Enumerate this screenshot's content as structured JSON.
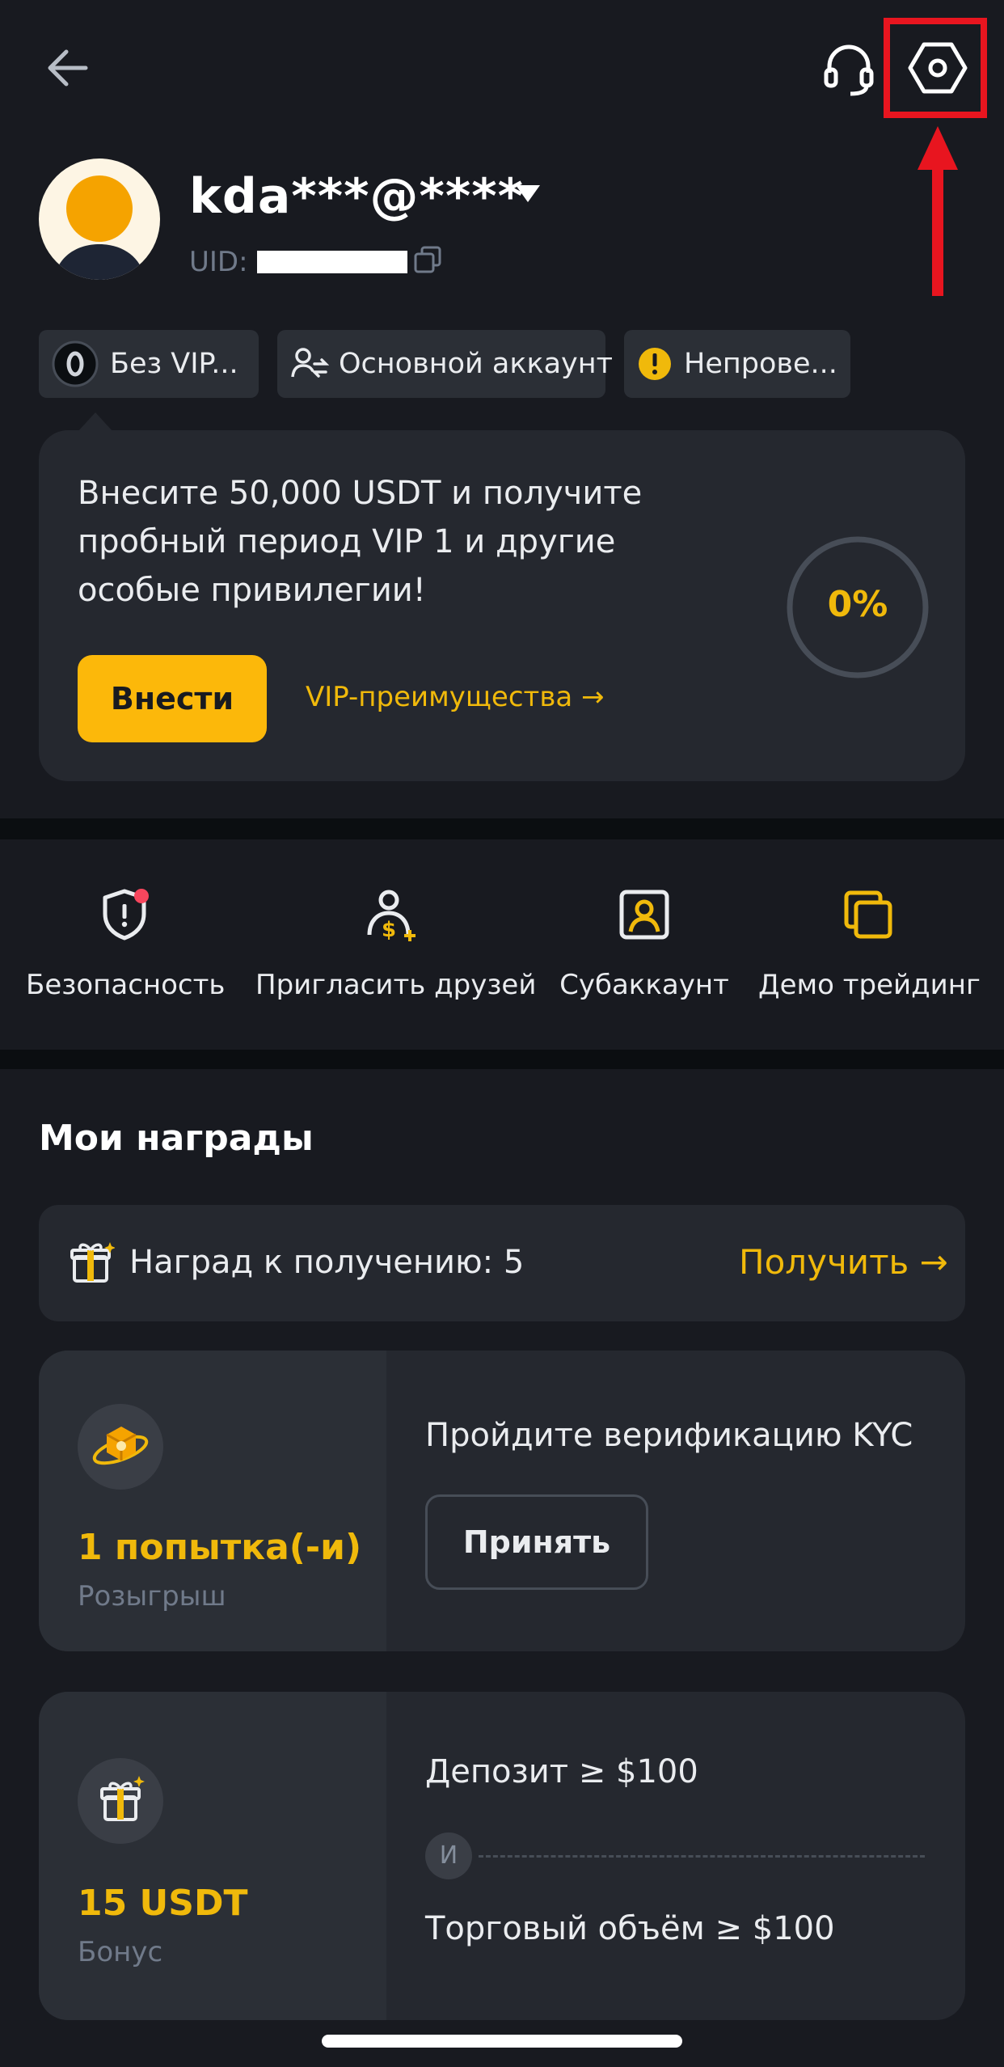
{
  "header": {
    "back_icon": "arrow-left-icon",
    "support_icon": "headset-icon",
    "settings_icon": "hexagon-settings-icon",
    "highlight_color": "#e8151f"
  },
  "profile": {
    "username": "kda***@****",
    "uid_label": "UID:"
  },
  "tags": [
    {
      "label": "Без VIP...",
      "icon": "vip-zero-icon"
    },
    {
      "label": "Основной аккаунт",
      "icon": "user-switch-icon"
    },
    {
      "label": "Непрове...",
      "icon": "warning-circle-icon"
    }
  ],
  "vip_promo": {
    "text": "Внесите 50,000 USDT и получите пробный период VIP 1 и другие особые привилегии!",
    "progress_label": "0%",
    "progress": 0,
    "deposit_button": "Внести",
    "benefits_link": "VIP-преимущества →"
  },
  "quick_actions": [
    {
      "label": "Безопасность",
      "icon": "shield-alert-icon"
    },
    {
      "label": "Пригласить друзей",
      "icon": "invite-friends-icon"
    },
    {
      "label": "Субаккаунт",
      "icon": "subaccount-icon"
    },
    {
      "label": "Демо трейдинг",
      "icon": "demo-trading-icon"
    }
  ],
  "rewards": {
    "title": "Мои награды",
    "claim_text": "Наград к получению: 5",
    "claim_link": "Получить →",
    "cards": [
      {
        "value": "1 попытка(-и)",
        "sub": "Розыгрыш",
        "task": "Пройдите верификацию KYC",
        "button": "Принять"
      },
      {
        "value": "15 USDT",
        "sub": "Бонус",
        "condition1": "Депозит ≥ $100",
        "and_label": "И",
        "condition2": "Торговый объём ≥ $100"
      }
    ]
  },
  "colors": {
    "accent": "#f0b90b",
    "background": "#181a20",
    "card": "#25282f"
  }
}
